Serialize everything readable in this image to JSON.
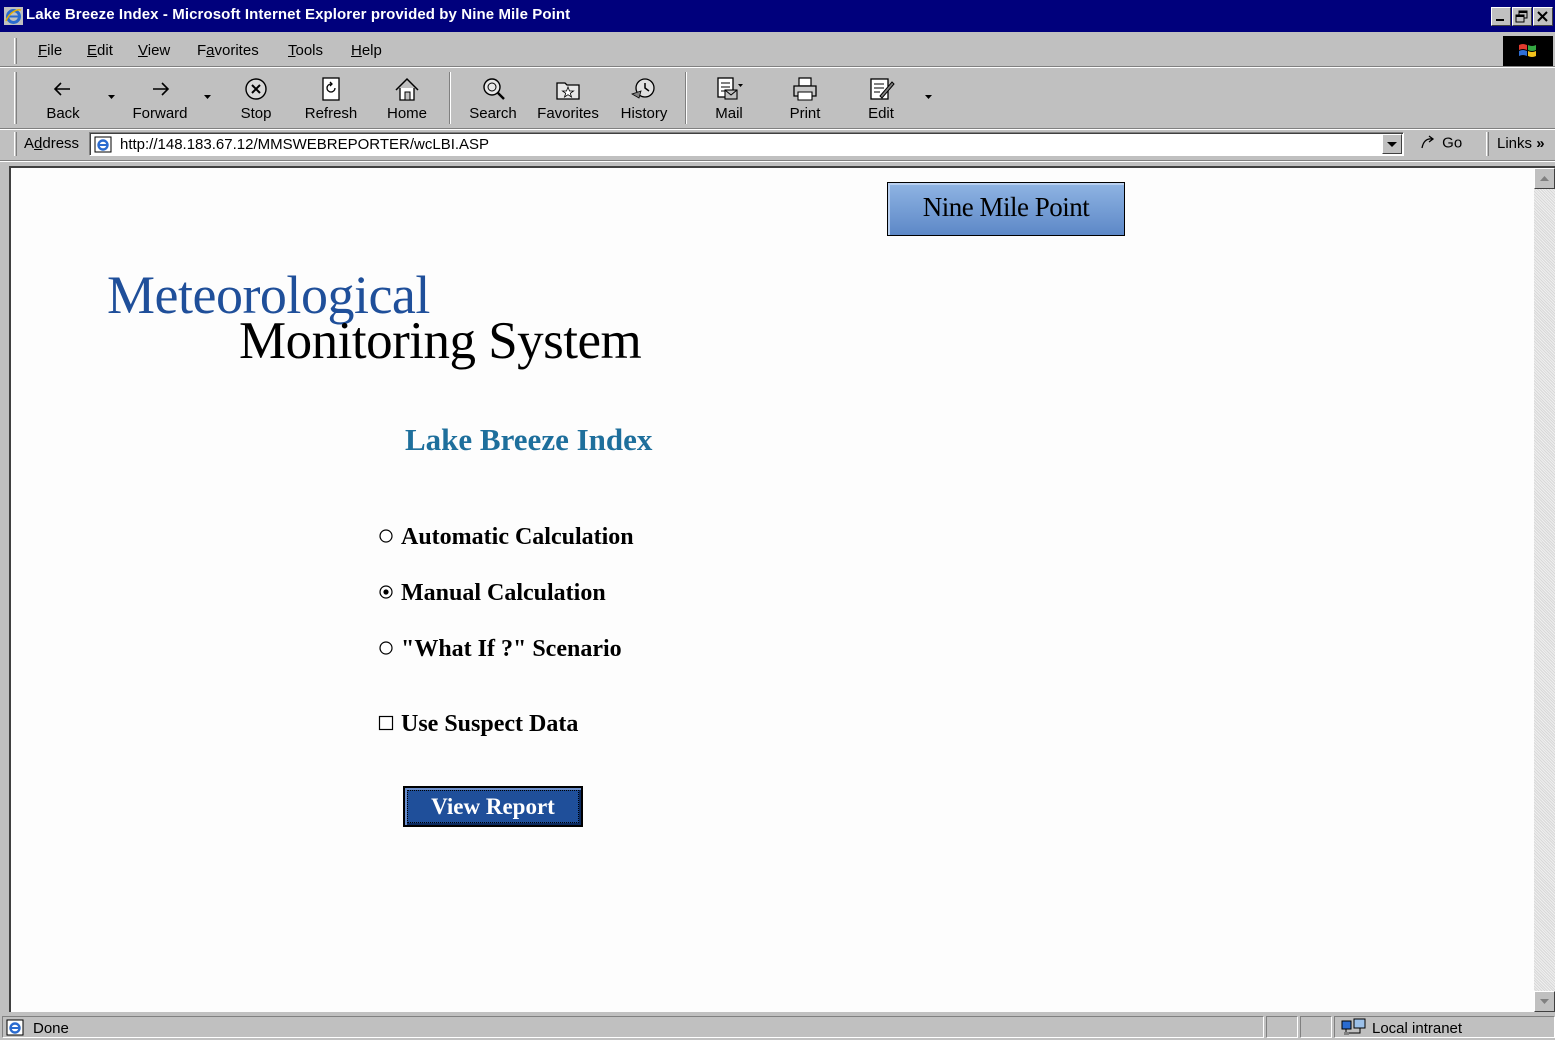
{
  "window": {
    "title": "Lake Breeze Index - Microsoft Internet Explorer provided by Nine Mile Point"
  },
  "menu": {
    "items": [
      {
        "label": "File",
        "accel": "F"
      },
      {
        "label": "Edit",
        "accel": "E"
      },
      {
        "label": "View",
        "accel": "V"
      },
      {
        "label": "Favorites",
        "accel": "a"
      },
      {
        "label": "Tools",
        "accel": "T"
      },
      {
        "label": "Help",
        "accel": "H"
      }
    ]
  },
  "toolbar": {
    "back": "Back",
    "forward": "Forward",
    "stop": "Stop",
    "refresh": "Refresh",
    "home": "Home",
    "search": "Search",
    "favorites": "Favorites",
    "history": "History",
    "mail": "Mail",
    "print": "Print",
    "edit": "Edit"
  },
  "address": {
    "label": "Address",
    "url": "http://148.183.67.12/MMSWEBREPORTER/wcLBI.ASP",
    "go": "Go",
    "links": "Links"
  },
  "page": {
    "banner": "Nine Mile Point",
    "logo_line1": "Meteorological",
    "logo_line2": "Monitoring System",
    "heading": "Lake Breeze Index",
    "options": [
      {
        "label": "Automatic Calculation",
        "selected": false
      },
      {
        "label": "Manual Calculation",
        "selected": true
      },
      {
        "label": "\"What If ?\" Scenario",
        "selected": false
      }
    ],
    "suspect_checkbox": {
      "label": "Use Suspect Data",
      "checked": false
    },
    "view_button": "View Report"
  },
  "status": {
    "text": "Done",
    "zone": "Local intranet"
  },
  "colors": {
    "title_bar": "#00007c",
    "logo_blue": "#1f4f9a",
    "heading_teal": "#1e6f9c",
    "button_blue": "#1f4f9a"
  }
}
